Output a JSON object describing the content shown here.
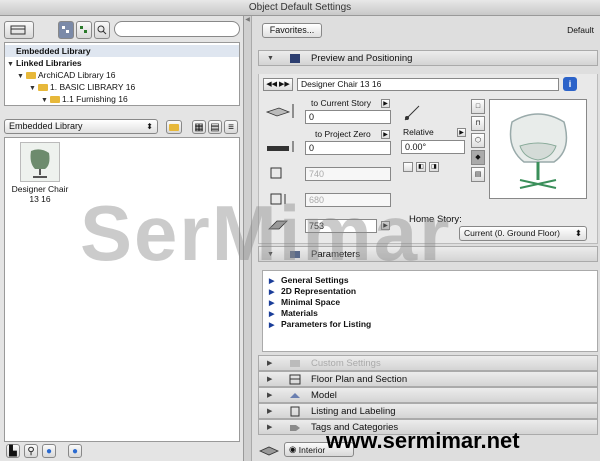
{
  "window": {
    "title": "Object Default Settings"
  },
  "tree": {
    "items": [
      {
        "label": "Embedded Library",
        "level": 0,
        "selected": true
      },
      {
        "label": "Linked Libraries",
        "level": 0,
        "expanded": true
      },
      {
        "label": "ArchiCAD Library 16",
        "level": 1,
        "expanded": true
      },
      {
        "label": "1. BASIC LIBRARY 16",
        "level": 2,
        "expanded": true
      },
      {
        "label": "1.1 Furnishing 16",
        "level": 3,
        "expanded": true
      }
    ]
  },
  "library_select": {
    "value": "Embedded Library"
  },
  "library_items": [
    {
      "label": "Designer Chair 13 16",
      "label_line1": "Designer Chair",
      "label_line2": "13 16"
    }
  ],
  "favorites_button": "Favorites...",
  "default_label": "Default",
  "preview_section": {
    "title": "Preview and Positioning",
    "object_name": "Designer Chair 13 16",
    "to_current_story_label": "to Current Story",
    "to_current_story_value": "0",
    "to_project_zero_label": "to Project Zero",
    "to_project_zero_value": "0",
    "relative_label": "Relative",
    "angle_value": "0.00°",
    "dim1": "740",
    "dim2": "680",
    "dim3": "753",
    "home_story_label": "Home Story:",
    "home_story_value": "Current (0. Ground Floor)"
  },
  "parameters_section": {
    "title": "Parameters",
    "items": [
      "General Settings",
      "2D Representation",
      "Minimal Space",
      "Materials",
      "Parameters for Listing"
    ]
  },
  "collapsed_sections": [
    {
      "title": "Custom Settings",
      "dim": true
    },
    {
      "title": "Floor Plan and Section",
      "dim": false
    },
    {
      "title": "Model",
      "dim": false
    },
    {
      "title": "Listing and Labeling",
      "dim": false
    },
    {
      "title": "Tags and Categories",
      "dim": false
    }
  ],
  "footer": {
    "layer_label": "Interior"
  },
  "watermark": "SerMimar",
  "website": "www.sermimar.net"
}
